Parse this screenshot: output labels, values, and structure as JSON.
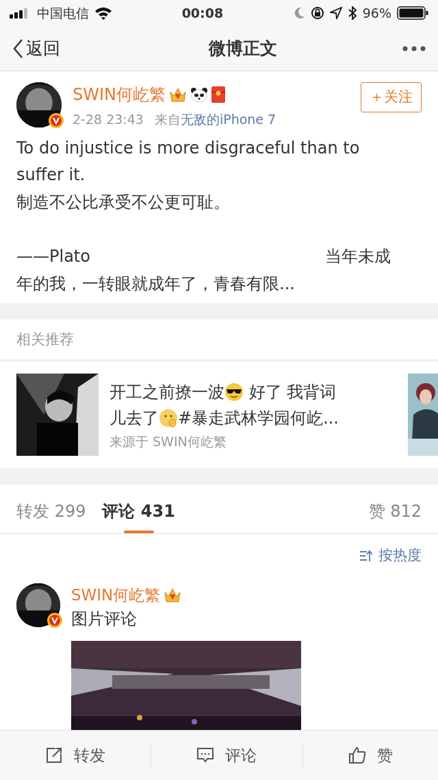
{
  "status_bar": {
    "carrier": "中国电信",
    "time": "00:08",
    "battery": "96%"
  },
  "nav": {
    "back": "返回",
    "title": "微博正文"
  },
  "post": {
    "author": "SWIN何屹繁",
    "time": "2-28 23:43",
    "source_prefix": "来自",
    "source": "无敌的iPhone 7",
    "follow": "＋关注",
    "followed": false,
    "text": "To do injustice is more disgraceful than to suffer it.\n制造不公比承受不公更可耻。\n\n——Plato                                             当年未成年的我，一转眼就成年了，青春有限..."
  },
  "related": {
    "header": "相关推荐",
    "lines": [
      [
        {
          "kind": "text",
          "text": "开工之前撩一波"
        },
        {
          "kind": "shades"
        },
        {
          "kind": "text",
          "text": " 好了 我背词"
        }
      ],
      [
        {
          "kind": "text",
          "text": "儿去了"
        },
        {
          "kind": "ponder"
        },
        {
          "kind": "text",
          "text": "#暴走武林学园何屹..."
        }
      ]
    ],
    "source": "来源于 SWIN何屹繁"
  },
  "tabs": [
    {
      "label": "转发",
      "count": "299",
      "selected": false
    },
    {
      "label": "评论",
      "count": "431",
      "selected": true
    },
    {
      "label": "赞",
      "count": "812",
      "selected": false
    }
  ],
  "sort": "按热度",
  "comment": {
    "author": "SWIN何屹繁",
    "text": "图片评论"
  },
  "toolbar": [
    {
      "kind": "share",
      "label": "转发"
    },
    {
      "kind": "comment",
      "label": "评论"
    },
    {
      "kind": "like",
      "label": "赞"
    }
  ]
}
